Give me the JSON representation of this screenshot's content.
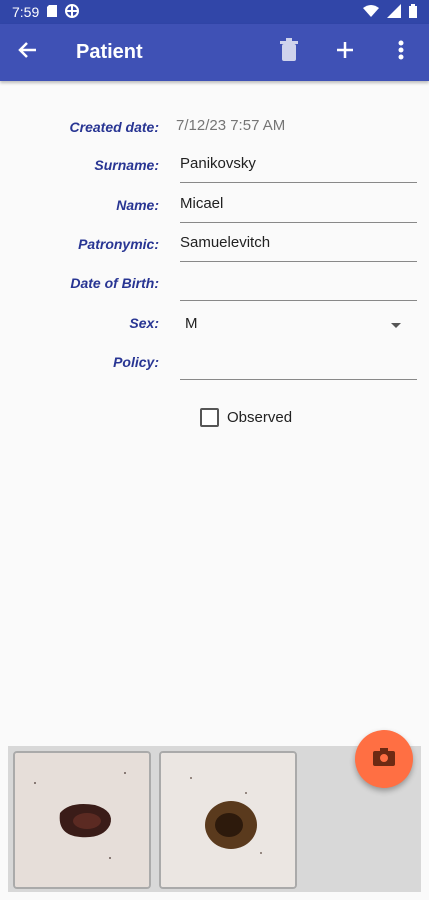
{
  "status_bar": {
    "time": "7:59"
  },
  "toolbar": {
    "title": "Patient"
  },
  "form": {
    "created_date": {
      "label": "Created date:",
      "value": "7/12/23 7:57 AM"
    },
    "surname": {
      "label": "Surname:",
      "value": "Panikovsky"
    },
    "name": {
      "label": "Name:",
      "value": "Micael"
    },
    "patronymic": {
      "label": "Patronymic:",
      "value": "Samuelevitch"
    },
    "birth": {
      "label": "Date of Birth:",
      "value": ""
    },
    "sex": {
      "label": "Sex:",
      "value": "M"
    },
    "policy": {
      "label": "Policy:",
      "value": ""
    },
    "observed": {
      "label": "Observed",
      "checked": false
    }
  },
  "colors": {
    "appbar": "#3f51b5",
    "fab": "#ff6f43",
    "label": "#283593"
  },
  "icons": [
    "arrow-left-icon",
    "trash-icon",
    "plus-icon",
    "more-vert-icon",
    "camera-icon"
  ]
}
